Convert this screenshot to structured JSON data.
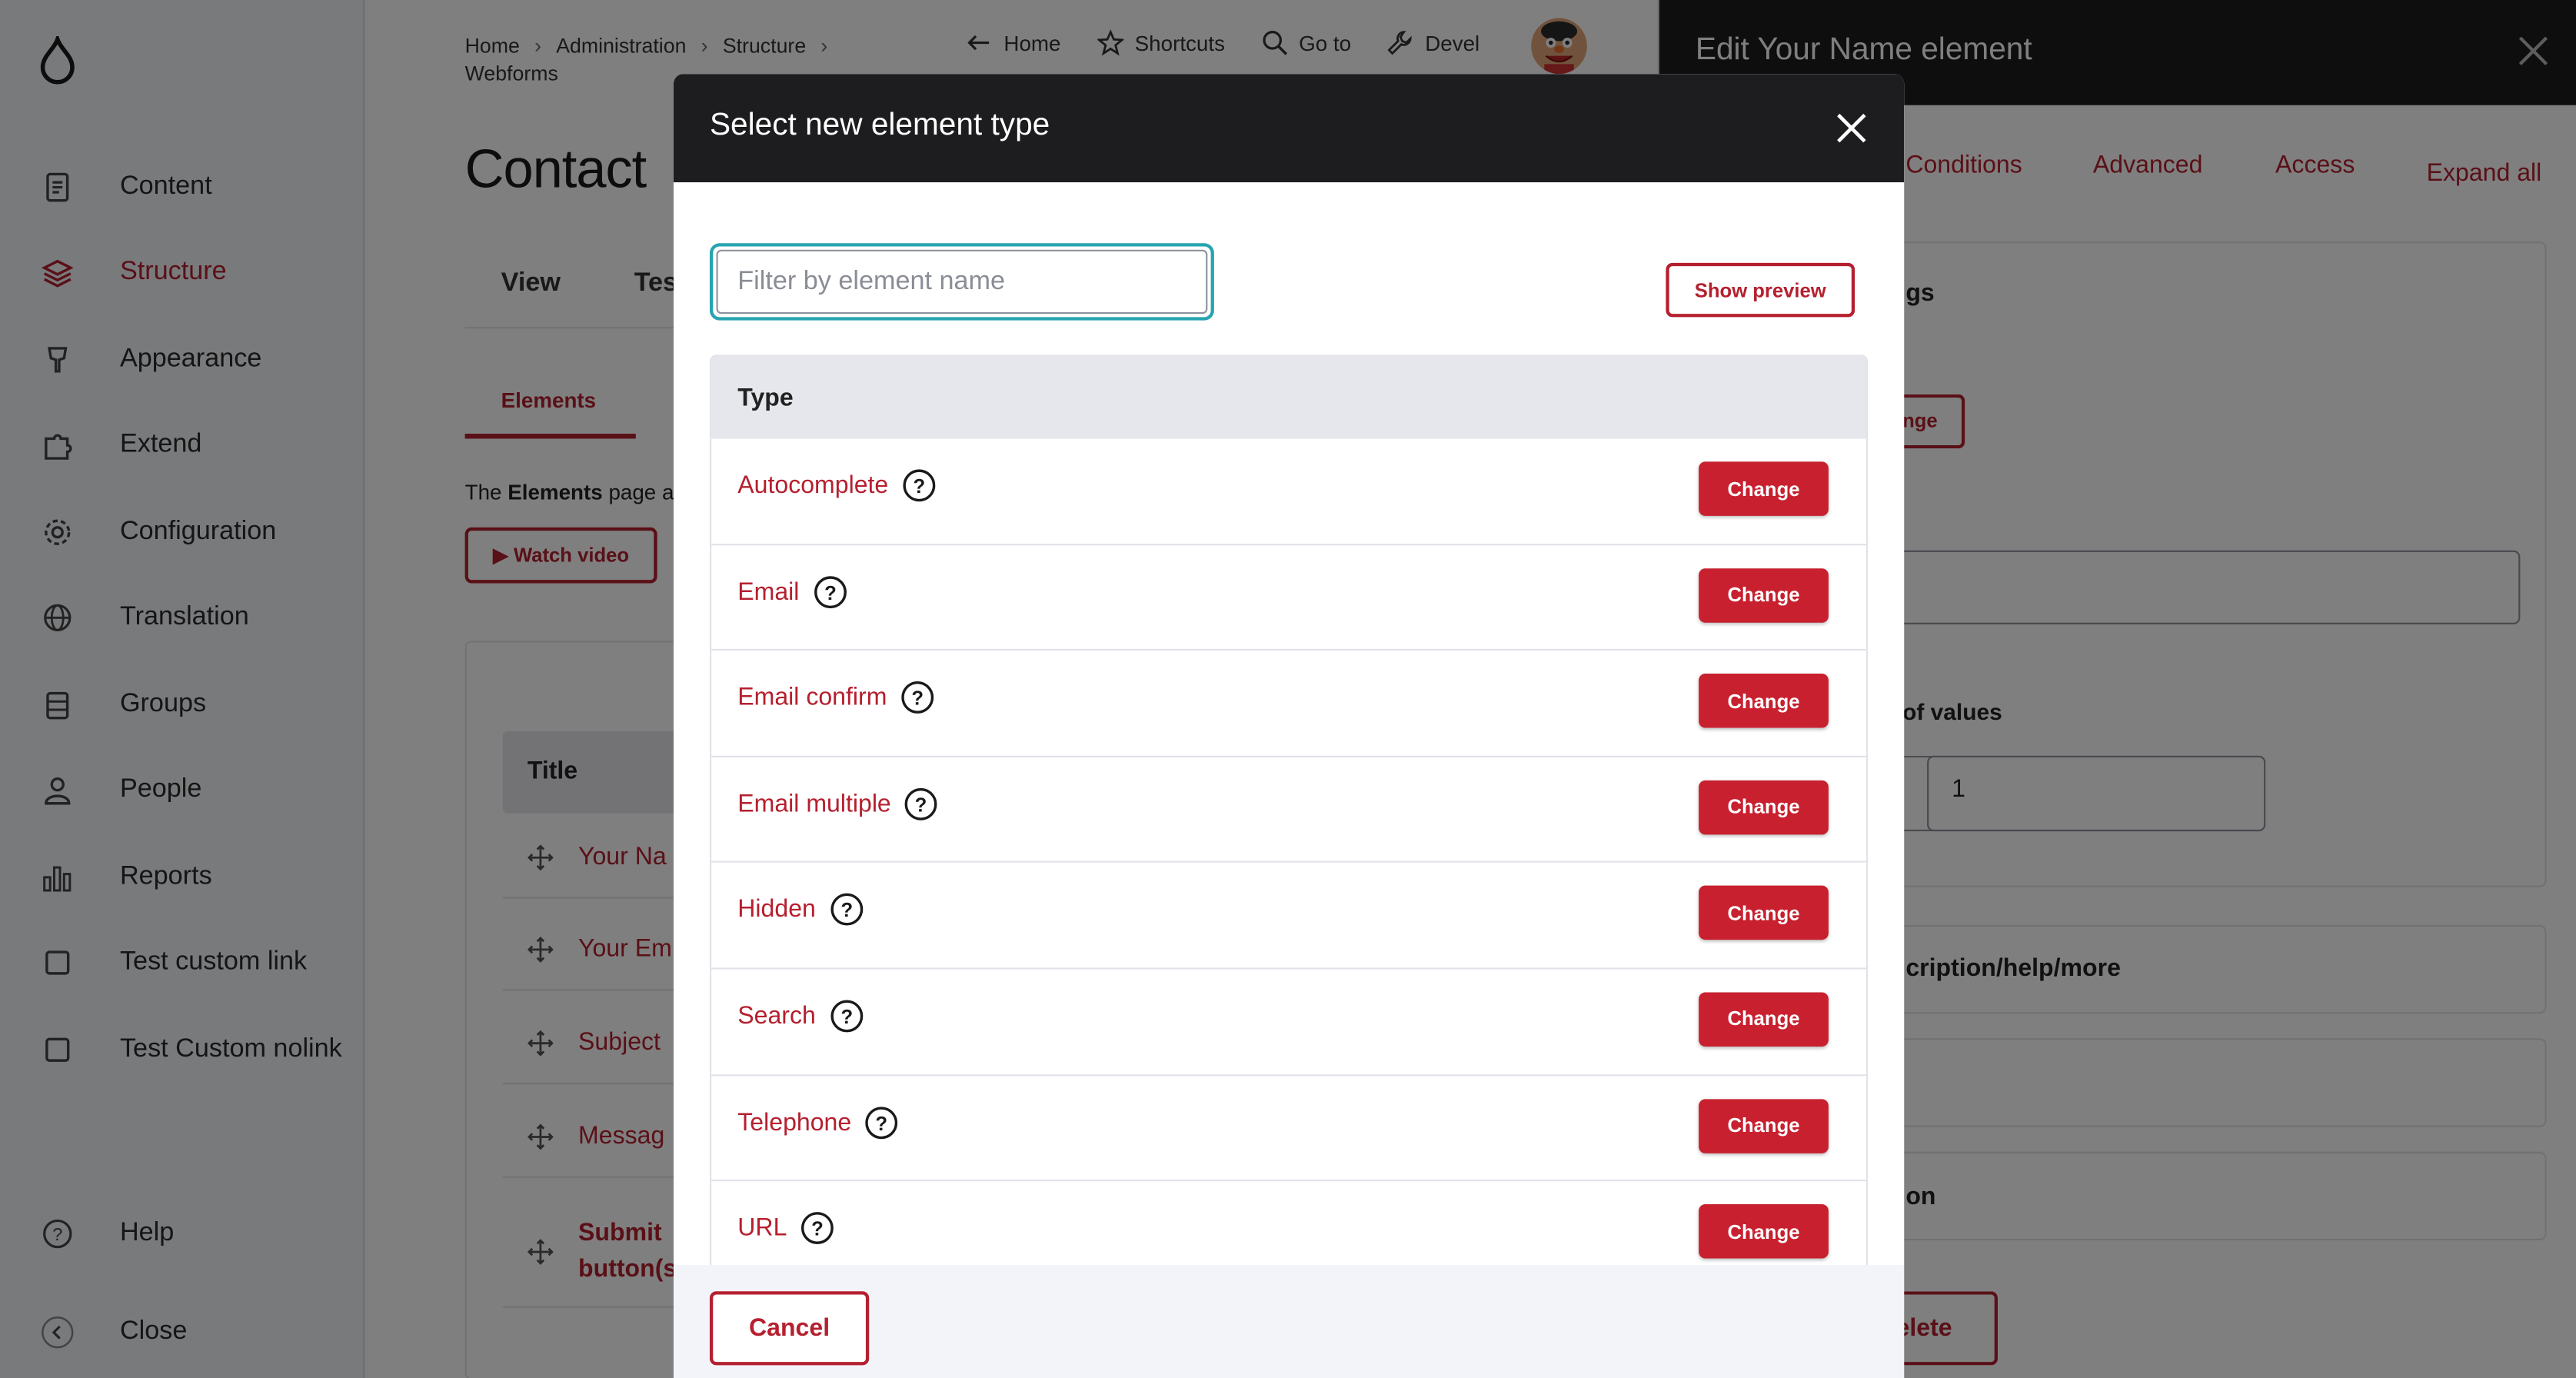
{
  "sidebar": {
    "items": [
      {
        "label": "Content",
        "icon": "content-icon"
      },
      {
        "label": "Structure",
        "icon": "structure-icon",
        "active": true
      },
      {
        "label": "Appearance",
        "icon": "appearance-icon"
      },
      {
        "label": "Extend",
        "icon": "extend-icon"
      },
      {
        "label": "Configuration",
        "icon": "configuration-icon"
      },
      {
        "label": "Translation",
        "icon": "translation-icon"
      },
      {
        "label": "Groups",
        "icon": "groups-icon"
      },
      {
        "label": "People",
        "icon": "people-icon"
      },
      {
        "label": "Reports",
        "icon": "reports-icon"
      },
      {
        "label": "Test custom link",
        "icon": "square-icon"
      },
      {
        "label": "Test Custom nolink",
        "icon": "square-icon"
      }
    ],
    "help": "Help",
    "close": "Close"
  },
  "breadcrumb": [
    "Home",
    "Administration",
    "Structure",
    "Webforms"
  ],
  "toolbar": {
    "home": "Home",
    "shortcuts": "Shortcuts",
    "goto": "Go to",
    "devel": "Devel"
  },
  "page": {
    "title": "Contact",
    "tabs": [
      "View",
      "Tes"
    ],
    "subtab": "Elements",
    "desc_prefix": "The ",
    "desc_bold": "Elements",
    "desc_suffix": " page a",
    "watch_video": "▶ Watch video",
    "table_header": "Title",
    "rows": [
      "Your Na",
      "Your Em",
      "Subject",
      "Messag",
      "Submit button(s"
    ]
  },
  "offcanvas": {
    "title": "Edit Your Name element",
    "tabs": [
      "Conditions",
      "Advanced",
      "Access"
    ],
    "expand_all": "Expand all",
    "settings_partial": "gs",
    "change_partial": "nge",
    "values_label": "of values",
    "values_value": "1",
    "desc_section": "cription/help/more",
    "section_partial": "on",
    "delete_partial": "elete"
  },
  "dialog": {
    "title": "Select new element type",
    "filter_placeholder": "Filter by element name",
    "show_preview": "Show preview",
    "type_header": "Type",
    "types": [
      "Autocomplete",
      "Email",
      "Email confirm",
      "Email multiple",
      "Hidden",
      "Search",
      "Telephone",
      "URL"
    ],
    "change_label": "Change",
    "cancel": "Cancel"
  },
  "colors": {
    "accent": "#b5202f",
    "button": "#c8202f",
    "header": "#1d1d1f",
    "focus": "#26a4b0"
  }
}
